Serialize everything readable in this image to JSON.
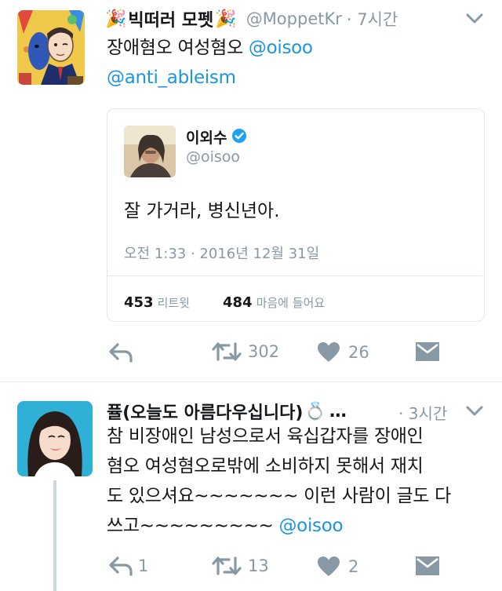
{
  "tweet1": {
    "display_name": "빅떠러 모펫",
    "name_emoji": "🎉",
    "handle": "@MoppetKr",
    "time": "· 7시간",
    "text_plain": "장애혐오 여성혐오 ",
    "mention1": "@oisoo",
    "mention2": "@anti_ableism",
    "avatar_icon": "cartoon-portrait",
    "quoted": {
      "display_name": "이외수",
      "verified_icon": "verified-badge",
      "handle": "@oisoo",
      "text": "잘 가거라, 병신년아.",
      "timestamp": "오전 1:33 · 2016년 12월 31일",
      "retweet_count": "453",
      "retweet_label": "리트윗",
      "like_count": "484",
      "like_label": "마음에 들어요"
    },
    "actions": {
      "reply_count": "",
      "retweet_count": "302",
      "like_count": "26"
    }
  },
  "tweet2": {
    "display_name": "퓰(오늘도 아름다우십니다)",
    "name_emoji": "💍",
    "ellipsis": "…",
    "time": "· 3시간",
    "text_lines": [
      "참 비장애인 남성으로서 육십갑자를 장애인",
      "혐오 여성혐오로밖에 소비하지 못해서 재치",
      "도 있으셔요~~~~~~~ 이런 사람이 글도 다"
    ],
    "text_last": "쓰고~~~~~~~~~ ",
    "mention": "@oisoo",
    "actions": {
      "reply_count": "1",
      "retweet_count": "13",
      "like_count": "2"
    }
  },
  "colors": {
    "link": "#1b95e0",
    "muted": "#8899a6",
    "verified": "#1da1f2",
    "border": "#e1e8ed"
  }
}
